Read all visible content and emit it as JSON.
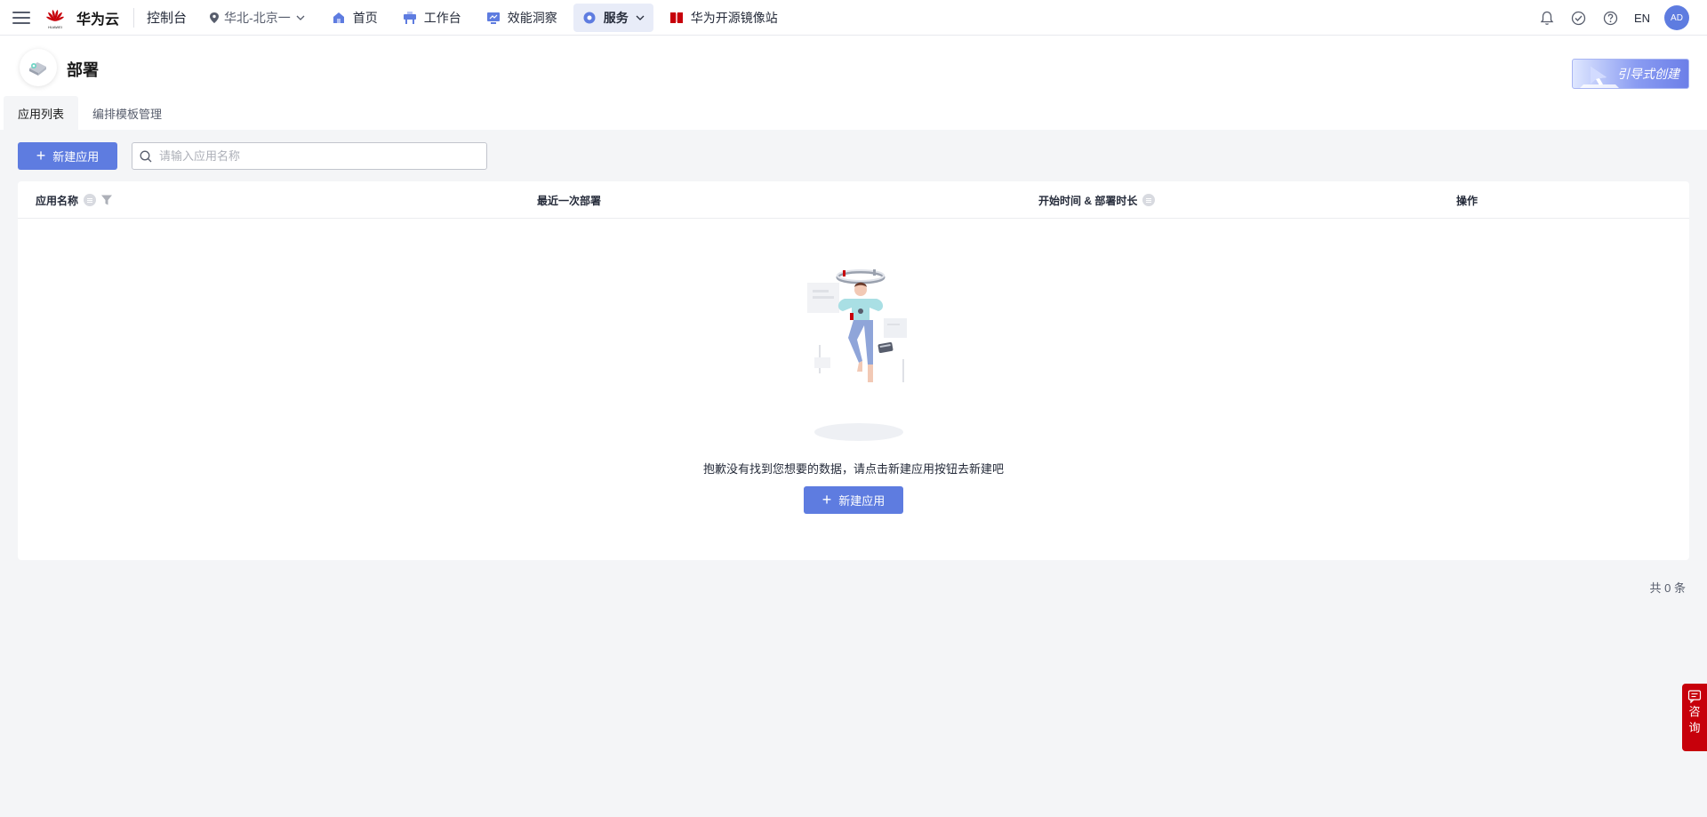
{
  "navbar": {
    "brand": "华为云",
    "brand_small": "HUAWEI",
    "console": "控制台",
    "region": "华北-北京一",
    "items": [
      {
        "label": "首页",
        "icon": "home-icon"
      },
      {
        "label": "工作台",
        "icon": "workbench-icon"
      },
      {
        "label": "效能洞察",
        "icon": "insight-icon"
      },
      {
        "label": "服务",
        "icon": "service-icon",
        "active": true
      },
      {
        "label": "华为开源镜像站",
        "icon": "mirror-icon"
      }
    ],
    "lang": "EN",
    "avatar": "AD"
  },
  "page": {
    "title": "部署",
    "guide_button": "引导式创建",
    "tabs": [
      {
        "label": "应用列表",
        "active": true
      },
      {
        "label": "编排模板管理",
        "active": false
      }
    ]
  },
  "toolbar": {
    "new_label": "新建应用",
    "search_placeholder": "请输入应用名称"
  },
  "table": {
    "columns": [
      "应用名称",
      "最近一次部署",
      "开始时间 & 部署时长",
      "操作"
    ],
    "rows": [],
    "empty_text": "抱歉没有找到您想要的数据，请点击新建应用按钮去新建吧",
    "empty_button": "新建应用"
  },
  "footer": {
    "total": "共 0 条"
  },
  "consult": {
    "chars": [
      "咨",
      "询"
    ]
  },
  "colors": {
    "primary": "#5e7ce0",
    "brand_red": "#c7000b",
    "background": "#f4f5f7"
  }
}
